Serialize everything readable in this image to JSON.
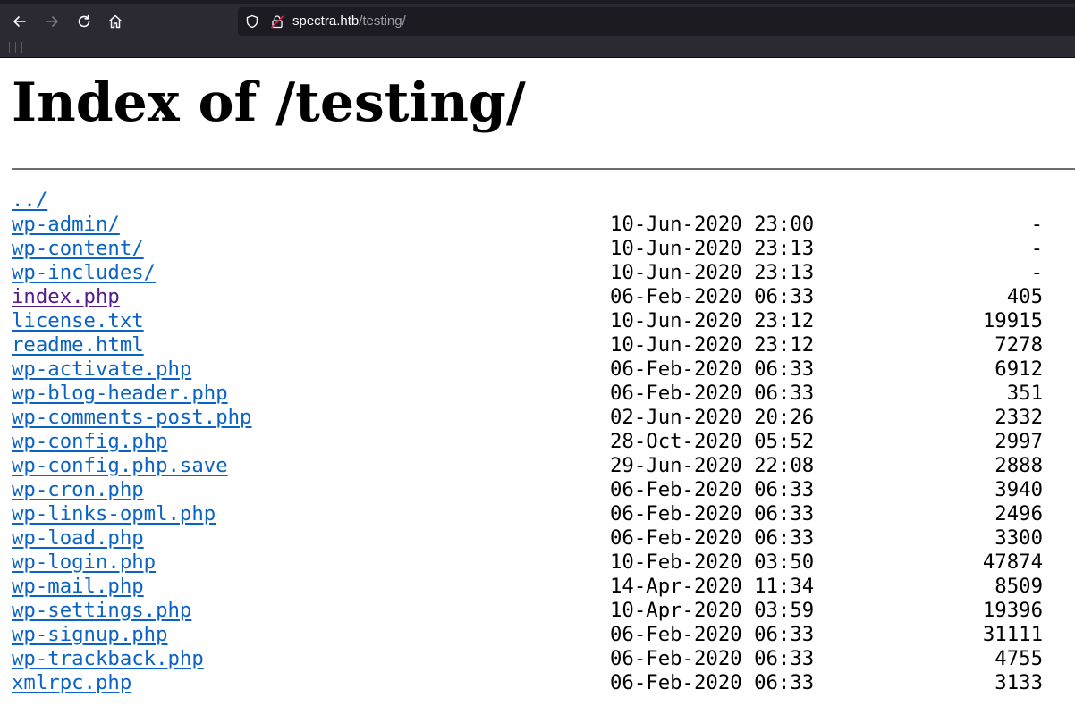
{
  "browser": {
    "url_host": "spectra.htb",
    "url_path": "/testing/",
    "icons": [
      "back-icon",
      "forward-icon",
      "reload-icon",
      "home-icon",
      "shield-icon",
      "insecure-lock-icon"
    ]
  },
  "page": {
    "title": "Index of /testing/"
  },
  "listing": [
    {
      "name": "../",
      "date": "",
      "size": "",
      "visited": false
    },
    {
      "name": "wp-admin/",
      "date": "10-Jun-2020 23:00",
      "size": "-",
      "visited": false
    },
    {
      "name": "wp-content/",
      "date": "10-Jun-2020 23:13",
      "size": "-",
      "visited": false
    },
    {
      "name": "wp-includes/",
      "date": "10-Jun-2020 23:13",
      "size": "-",
      "visited": false
    },
    {
      "name": "index.php",
      "date": "06-Feb-2020 06:33",
      "size": "405",
      "visited": true
    },
    {
      "name": "license.txt",
      "date": "10-Jun-2020 23:12",
      "size": "19915",
      "visited": false
    },
    {
      "name": "readme.html",
      "date": "10-Jun-2020 23:12",
      "size": "7278",
      "visited": false
    },
    {
      "name": "wp-activate.php",
      "date": "06-Feb-2020 06:33",
      "size": "6912",
      "visited": false
    },
    {
      "name": "wp-blog-header.php",
      "date": "06-Feb-2020 06:33",
      "size": "351",
      "visited": false
    },
    {
      "name": "wp-comments-post.php",
      "date": "02-Jun-2020 20:26",
      "size": "2332",
      "visited": false
    },
    {
      "name": "wp-config.php",
      "date": "28-Oct-2020 05:52",
      "size": "2997",
      "visited": false
    },
    {
      "name": "wp-config.php.save",
      "date": "29-Jun-2020 22:08",
      "size": "2888",
      "visited": false
    },
    {
      "name": "wp-cron.php",
      "date": "06-Feb-2020 06:33",
      "size": "3940",
      "visited": false
    },
    {
      "name": "wp-links-opml.php",
      "date": "06-Feb-2020 06:33",
      "size": "2496",
      "visited": false
    },
    {
      "name": "wp-load.php",
      "date": "06-Feb-2020 06:33",
      "size": "3300",
      "visited": false
    },
    {
      "name": "wp-login.php",
      "date": "10-Feb-2020 03:50",
      "size": "47874",
      "visited": false
    },
    {
      "name": "wp-mail.php",
      "date": "14-Apr-2020 11:34",
      "size": "8509",
      "visited": false
    },
    {
      "name": "wp-settings.php",
      "date": "10-Apr-2020 03:59",
      "size": "19396",
      "visited": false
    },
    {
      "name": "wp-signup.php",
      "date": "06-Feb-2020 06:33",
      "size": "31111",
      "visited": false
    },
    {
      "name": "wp-trackback.php",
      "date": "06-Feb-2020 06:33",
      "size": "4755",
      "visited": false
    },
    {
      "name": "xmlrpc.php",
      "date": "06-Feb-2020 06:33",
      "size": "3133",
      "visited": false
    }
  ],
  "colors": {
    "link": "#0b63c3",
    "visited_link": "#551a8b",
    "chrome_bg": "#2b2a33",
    "urlbar_bg": "#1c1b22"
  }
}
